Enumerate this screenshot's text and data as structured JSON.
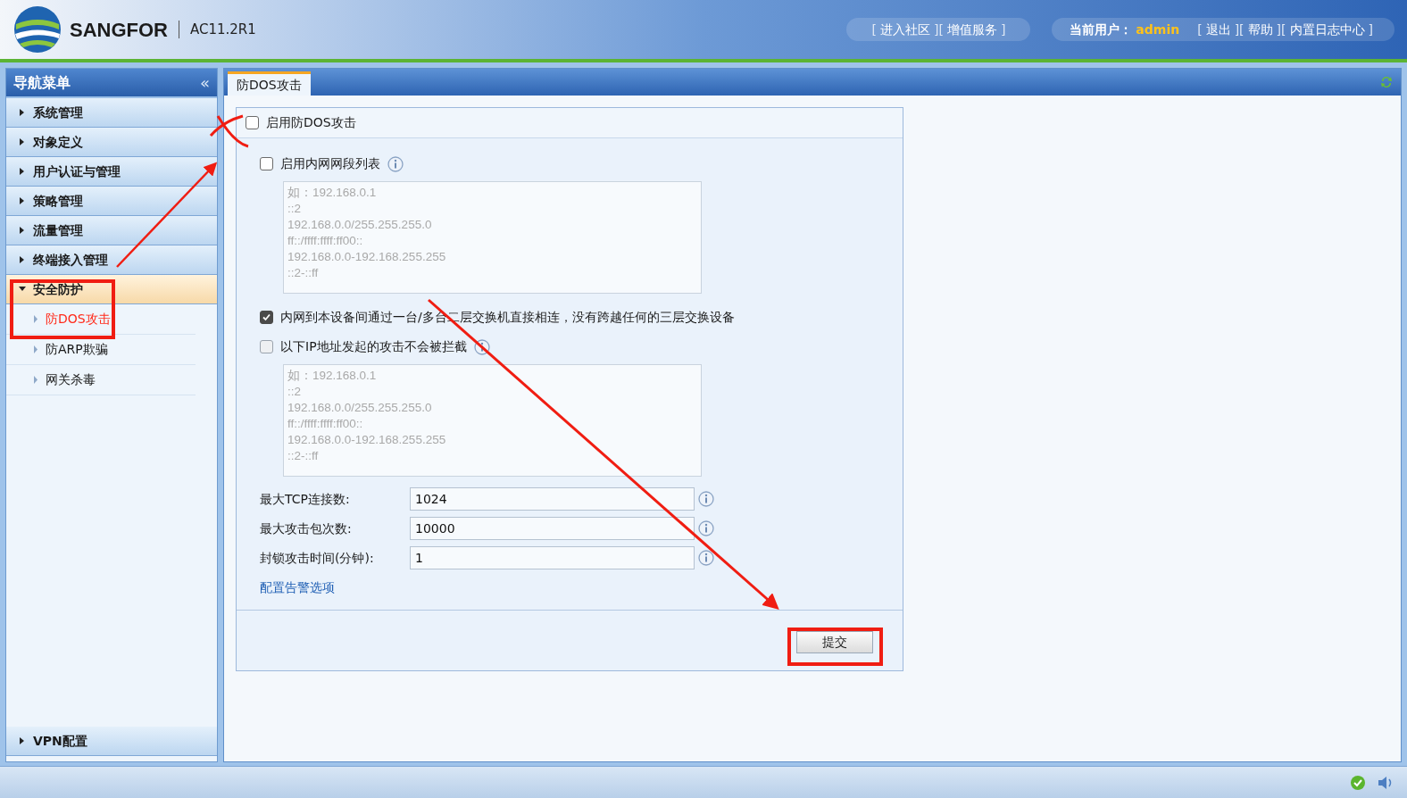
{
  "header": {
    "brand": "SANGFOR",
    "version": "AC11.2R1",
    "service_links": {
      "brackets": [
        "[",
        "][",
        "]"
      ],
      "items": [
        "进入社区",
        "增值服务"
      ]
    },
    "user_label": "当前用户：",
    "user_name": "admin",
    "account_links": {
      "brackets": [
        "[",
        "][",
        "][",
        "]"
      ],
      "items": [
        "退出",
        "帮助",
        "内置日志中心"
      ]
    }
  },
  "sidebar": {
    "title": "导航菜单",
    "collapse_glyph": "«",
    "items": [
      {
        "label": "系统管理",
        "expanded": false
      },
      {
        "label": "对象定义",
        "expanded": false
      },
      {
        "label": "用户认证与管理",
        "expanded": false
      },
      {
        "label": "策略管理",
        "expanded": false
      },
      {
        "label": "流量管理",
        "expanded": false
      },
      {
        "label": "终端接入管理",
        "expanded": false
      },
      {
        "label": "安全防护",
        "expanded": true,
        "children": [
          {
            "label": "防DOS攻击",
            "selected": true
          },
          {
            "label": "防ARP欺骗",
            "selected": false
          },
          {
            "label": "网关杀毒",
            "selected": false
          }
        ]
      }
    ],
    "bottom_items": [
      {
        "label": "VPN配置",
        "expanded": false
      }
    ]
  },
  "tabs": [
    {
      "label": "防DOS攻击",
      "selected": true
    }
  ],
  "form": {
    "enable": {
      "label": "启用防DOS攻击",
      "checked": false
    },
    "internal_list": {
      "label": "启用内网网段列表",
      "checked": false,
      "placeholder": "如：192.168.0.1\n::2\n192.168.0.0/255.255.255.0\nff::/ffff:ffff:ff00::\n192.168.0.0-192.168.255.255\n::2-::ff"
    },
    "direct_connect": {
      "label": "内网到本设备间通过一台/多台二层交换机直接相连，没有跨越任何的三层交换设备",
      "checked": true
    },
    "whitelist": {
      "label": "以下IP地址发起的攻击不会被拦截",
      "checked": false,
      "placeholder": "如：192.168.0.1\n::2\n192.168.0.0/255.255.255.0\nff::/ffff:ffff:ff00::\n192.168.0.0-192.168.255.255\n::2-::ff"
    },
    "fields": [
      {
        "label": "最大TCP连接数:",
        "value": "1024"
      },
      {
        "label": "最大攻击包次数:",
        "value": "10000"
      },
      {
        "label": "封锁攻击时间(分钟):",
        "value": "1"
      }
    ],
    "alert_link": "配置告警选项",
    "submit": "提交"
  }
}
